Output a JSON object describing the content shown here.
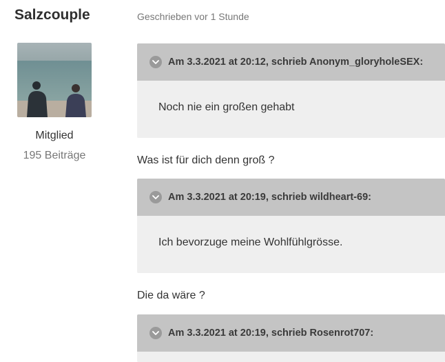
{
  "author": {
    "name": "Salzcouple",
    "role": "Mitglied",
    "posts": "195 Beiträge"
  },
  "post": {
    "meta": "Geschrieben vor 1 Stunde",
    "quotes": [
      {
        "title": "Am 3.3.2021 at 20:12, schrieb Anonym_gloryholeSEX:",
        "body": "Noch nie ein großen gehabt"
      },
      {
        "title": "Am 3.3.2021 at 20:19, schrieb wildheart-69:",
        "body": "Ich bevorzuge meine Wohlfühlgrösse."
      },
      {
        "title": "Am 3.3.2021 at 20:19, schrieb Rosenrot707:",
        "body": ""
      }
    ],
    "replies": [
      "Was ist für dich denn groß ?",
      "Die da wäre ?"
    ]
  },
  "icons": {
    "quote_toggle": "chevron-down-icon"
  },
  "colors": {
    "quote_header_bg": "#c4c4c4",
    "quote_body_bg": "#efefef",
    "meta_text": "#777777"
  }
}
